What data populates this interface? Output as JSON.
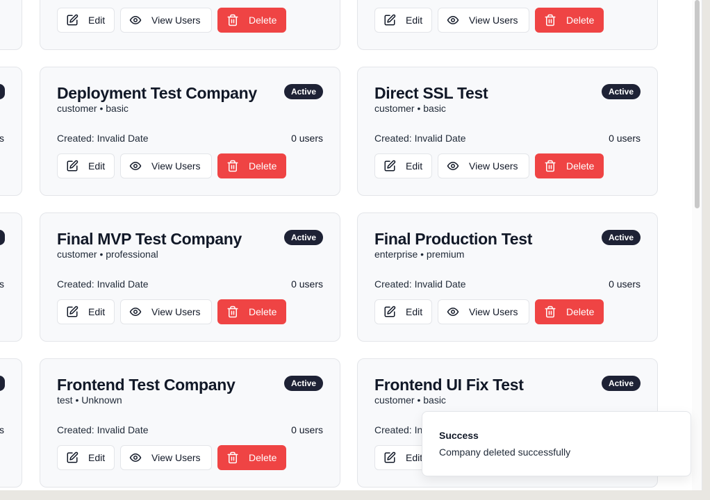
{
  "buttons": {
    "edit": "Edit",
    "view_users": "View Users",
    "delete": "Delete"
  },
  "left_partial": {
    "users_tail": "s"
  },
  "companies": [
    {
      "name": "",
      "subtitle": "",
      "status": "",
      "created": "",
      "users": ""
    },
    {
      "name": "",
      "subtitle": "",
      "status": "",
      "created": "",
      "users": ""
    },
    {
      "name": "Deployment Test Company",
      "subtitle": "customer • basic",
      "status": "Active",
      "created": "Created: Invalid Date",
      "users": "0 users"
    },
    {
      "name": "Direct SSL Test",
      "subtitle": "customer • basic",
      "status": "Active",
      "created": "Created: Invalid Date",
      "users": "0 users"
    },
    {
      "name": "Final MVP Test Company",
      "subtitle": "customer • professional",
      "status": "Active",
      "created": "Created: Invalid Date",
      "users": "0 users"
    },
    {
      "name": "Final Production Test",
      "subtitle": "enterprise • premium",
      "status": "Active",
      "created": "Created: Invalid Date",
      "users": "0 users"
    },
    {
      "name": "Frontend Test Company",
      "subtitle": "test • Unknown",
      "status": "Active",
      "created": "Created: Invalid Date",
      "users": "0 users"
    },
    {
      "name": "Frontend UI Fix Test",
      "subtitle": "customer • basic",
      "status": "Active",
      "created": "Created: In",
      "users": ""
    }
  ],
  "toast": {
    "title": "Success",
    "description": "Company deleted successfully"
  },
  "colors": {
    "danger": "#ef4444",
    "badge": "#1e2235",
    "card_bg": "#f8f9fb"
  }
}
